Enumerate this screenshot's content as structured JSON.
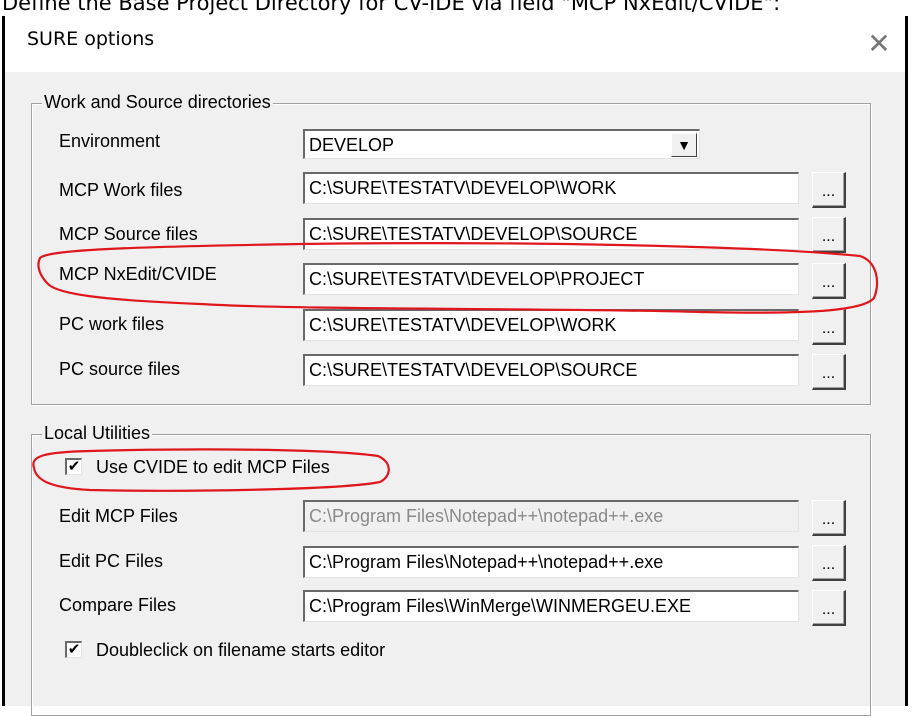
{
  "caption": "Define the Base Project Directory for CV-IDE via field \"MCP NxEdit/CVIDE\":",
  "window": {
    "title": "SURE options",
    "close_glyph": "✕"
  },
  "work_source": {
    "legend": "Work and Source directories",
    "environment": {
      "label": "Environment",
      "value": "DEVELOP"
    },
    "rows": [
      {
        "label": "MCP Work files",
        "value": "C:\\SURE\\TESTATV\\DEVELOP\\WORK",
        "button": "..."
      },
      {
        "label": "MCP Source files",
        "value": "C:\\SURE\\TESTATV\\DEVELOP\\SOURCE",
        "button": "..."
      },
      {
        "label": "MCP NxEdit/CVIDE",
        "value": "C:\\SURE\\TESTATV\\DEVELOP\\PROJECT",
        "button": "..."
      },
      {
        "label": "PC work files",
        "value": "C:\\SURE\\TESTATV\\DEVELOP\\WORK",
        "button": "..."
      },
      {
        "label": "PC source files",
        "value": "C:\\SURE\\TESTATV\\DEVELOP\\SOURCE",
        "button": "..."
      }
    ]
  },
  "local_utilities": {
    "legend": "Local Utilities",
    "use_cvide": {
      "label": "Use CVIDE to edit MCP Files",
      "checked": true,
      "mark": "✔"
    },
    "rows": [
      {
        "label": "Edit MCP Files",
        "value": "C:\\Program Files\\Notepad++\\notepad++.exe",
        "button": "...",
        "disabled": true
      },
      {
        "label": "Edit PC Files",
        "value": "C:\\Program Files\\Notepad++\\notepad++.exe",
        "button": "..."
      },
      {
        "label": "Compare Files",
        "value": "C:\\Program Files\\WinMerge\\WINMERGEU.EXE",
        "button": "..."
      }
    ],
    "doubleclick": {
      "label": "Doubleclick on filename starts editor",
      "checked": true,
      "mark": "✔"
    }
  },
  "annotation_color": "#e0161d"
}
